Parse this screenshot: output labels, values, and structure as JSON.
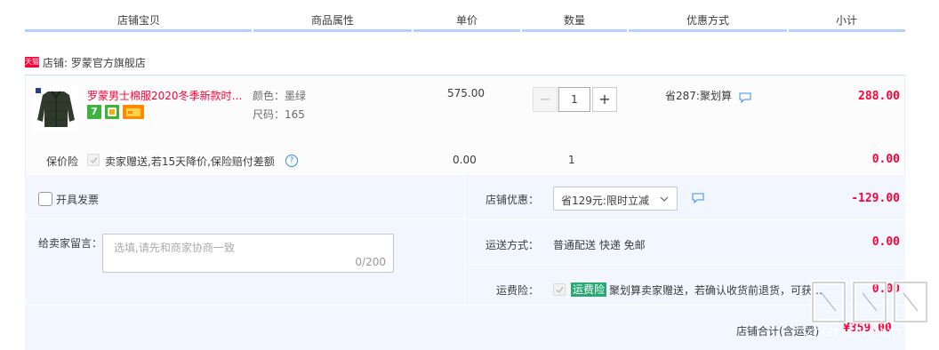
{
  "header": {
    "columns": [
      "店铺宝贝",
      "商品属性",
      "单价",
      "数量",
      "优惠方式",
      "小计"
    ]
  },
  "shop": {
    "badge": "天猫",
    "name": "店铺: 罗蒙官方旗舰店"
  },
  "item": {
    "title": "罗蒙男士棉服2020冬季新款时…",
    "attr_color": "颜色：墨绿",
    "attr_size": "尺码：165",
    "price": "575.00",
    "quantity": "1",
    "qty_minus": "−",
    "qty_plus": "+",
    "promo": "省287:聚划算",
    "subtotal": "288.00",
    "service_icon_1": "7"
  },
  "insurance": {
    "label": "保价险",
    "text": "卖家赠送,若15天降价,保险赔付差额",
    "help": "?",
    "price": "0.00",
    "quantity": "1",
    "subtotal": "0.00"
  },
  "order": {
    "invoice_label": "开具发票",
    "message_label": "给卖家留言：",
    "message_placeholder": "选填,请先和商家协商一致",
    "message_count": "0/200",
    "shop_discount_label": "店铺优惠：",
    "shop_discount_value": "省129元:限时立减",
    "shop_discount_amount": "-129.00",
    "shipping_label": "运送方式：",
    "shipping_value": "普通配送 快递 免邮",
    "shipping_amount": "0.00",
    "freight_label": "运费险：",
    "freight_tag": "运费险",
    "freight_text": "聚划算卖家赠送，若确认收货前退货，可获…",
    "freight_amount": "0.00",
    "total_label": "店铺合计(含运费)",
    "total_value": "¥359.00"
  },
  "watermark": {
    "text": "zhizhizhi.com"
  },
  "colors": {
    "accent_red": "#ff0036",
    "header_line": "#b2d1ff",
    "panel_bg": "#f2f7ff",
    "freight_tag": "#2aa873"
  }
}
